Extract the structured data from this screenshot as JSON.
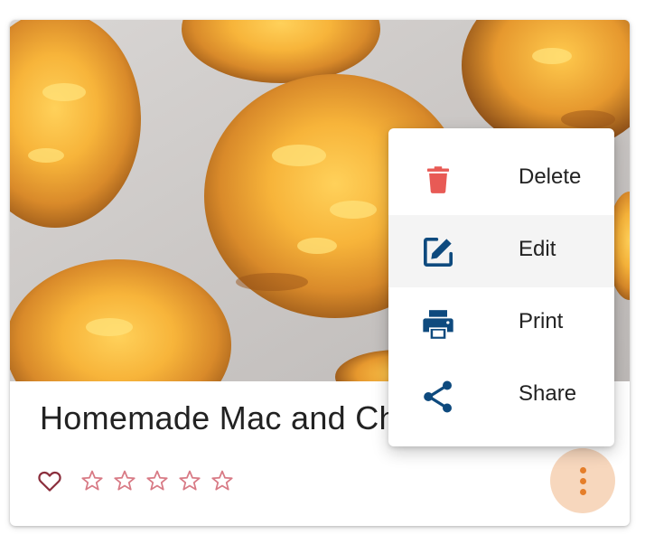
{
  "recipe": {
    "title": "Homemade Mac and Cheese Bites",
    "favorite_icon": "heart-outline-icon",
    "rating": {
      "value": 0,
      "max": 5,
      "star_icon": "star-outline-icon"
    }
  },
  "menu": {
    "items": [
      {
        "label": "Delete",
        "icon": "trash-icon",
        "color": "#e85a55"
      },
      {
        "label": "Edit",
        "icon": "edit-icon",
        "color": "#0e4a7e"
      },
      {
        "label": "Print",
        "icon": "printer-icon",
        "color": "#0e4a7e"
      },
      {
        "label": "Share",
        "icon": "share-icon",
        "color": "#0e4a7e"
      }
    ],
    "highlighted_index": 1
  },
  "more_button": {
    "icon": "more-vertical-icon",
    "color": "#e57e2a"
  },
  "colors": {
    "heart": "#8b2e3c",
    "star": "#d87a85",
    "more_bg": "#f7d7bd"
  }
}
